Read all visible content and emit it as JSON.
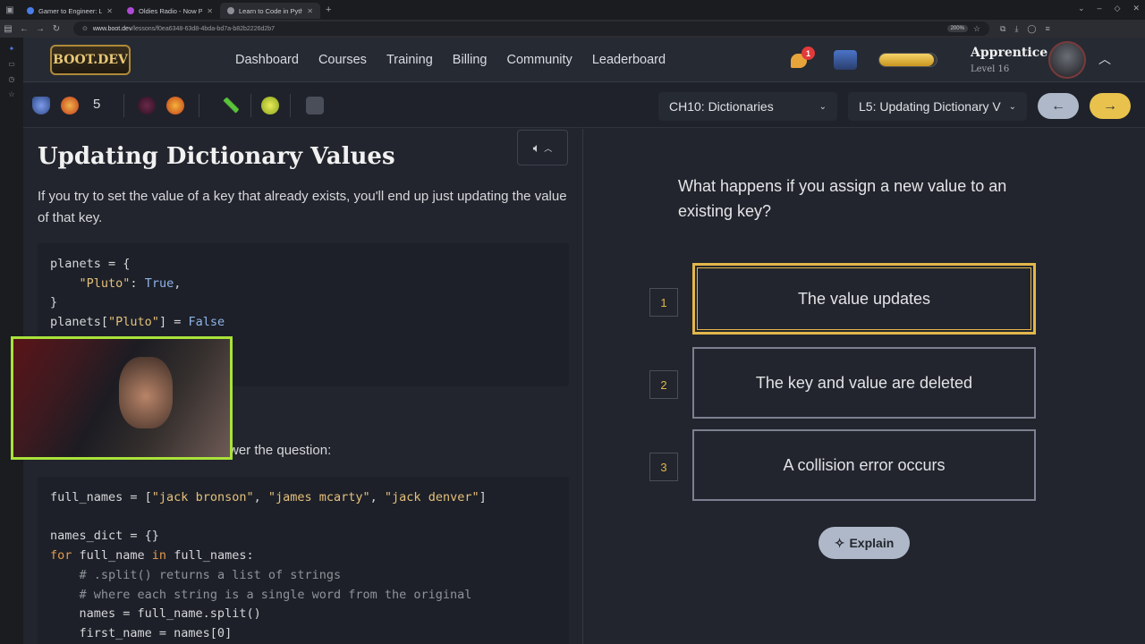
{
  "browser": {
    "tabs": [
      {
        "title": "Gamer to Engineer: Learni",
        "color": "#4a7de8"
      },
      {
        "title": "Oldies Radio - Now Playi",
        "color": "#b04ad6"
      },
      {
        "title": "Learn to Code in Python: L",
        "color": "#8c8f96"
      }
    ],
    "url_host": "www.boot.dev",
    "url_path": "/lessons/f0ea6348-63d8-4bda-bd7a-b82b2226d2b7",
    "zoom": "200%"
  },
  "header": {
    "logo": "BOOT.DEV",
    "menu": [
      "Dashboard",
      "Courses",
      "Training",
      "Billing",
      "Community",
      "Leaderboard"
    ],
    "notification_count": "1",
    "xp_fill": 0.95,
    "rank": "Apprentice",
    "level": "Level 16"
  },
  "subbar": {
    "streak": "5",
    "chapter": "CH10: Dictionaries",
    "lesson": "L5: Updating Dictionary V"
  },
  "lesson": {
    "title": "Updating Dictionary Values",
    "intro": "If you try to set the value of a key that already exists, you'll end up just updating the value of that key.",
    "answer_prompt_fragment": "wer the question:"
  },
  "quiz": {
    "question": "What happens if you assign a new value to an existing key?",
    "options": [
      {
        "num": "1",
        "text": "The value updates"
      },
      {
        "num": "2",
        "text": "The key and value are deleted"
      },
      {
        "num": "3",
        "text": "A collision error occurs"
      }
    ],
    "explain_label": "Explain"
  },
  "colors": {
    "accent_gold": "#e2b64a",
    "webcam_border": "#a9e23a",
    "panel_bg": "#22252d"
  }
}
